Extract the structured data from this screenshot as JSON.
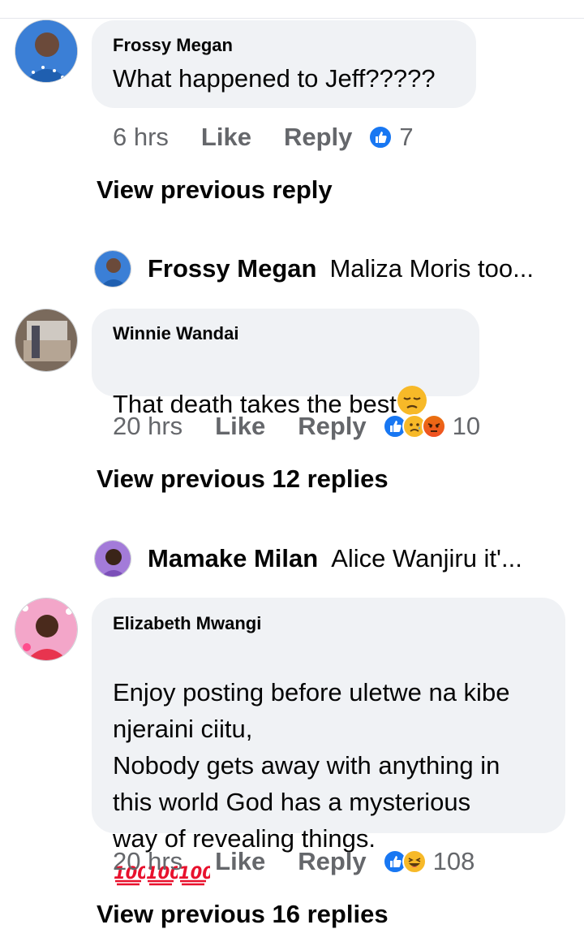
{
  "thread": [
    {
      "author": "Frossy Megan",
      "text": "What happened to Jeff?????",
      "time": "6 hrs",
      "like_label": "Like",
      "reply_label": "Reply",
      "reactions": [
        "like"
      ],
      "reaction_count": "7"
    },
    {
      "view_previous": "View previous reply",
      "collapsed_reply": {
        "author": "Frossy Megan",
        "snippet": "Maliza Moris too..."
      }
    },
    {
      "author": "Winnie Wandai",
      "text": "That death takes the best",
      "text_emoji": "pensive-face-emoji",
      "time": "20 hrs",
      "like_label": "Like",
      "reply_label": "Reply",
      "reactions": [
        "like",
        "sad",
        "angry"
      ],
      "reaction_count": "10"
    },
    {
      "view_previous": "View previous 12 replies",
      "collapsed_reply": {
        "author": "Mamake Milan",
        "snippet": "Alice Wanjiru it'..."
      }
    },
    {
      "author": "Elizabeth Mwangi",
      "text": "Enjoy posting before uletwe na kibe\nnjeraini ciitu,\nNobody gets away with anything in\nthis world God has a mysterious\nway of revealing things.",
      "text_emoji": "hundred-points-emoji ×3",
      "time": "20 hrs",
      "like_label": "Like",
      "reply_label": "Reply",
      "reactions": [
        "like",
        "haha"
      ],
      "reaction_count": "108"
    },
    {
      "view_previous": "View previous 16 replies"
    }
  ],
  "colors": {
    "bubble": "#f0f2f5",
    "meta_text": "#65676b",
    "like_blue": "#1877f2",
    "emoji_yellow": "#f7b928",
    "angry_orange": "#e9710f"
  }
}
